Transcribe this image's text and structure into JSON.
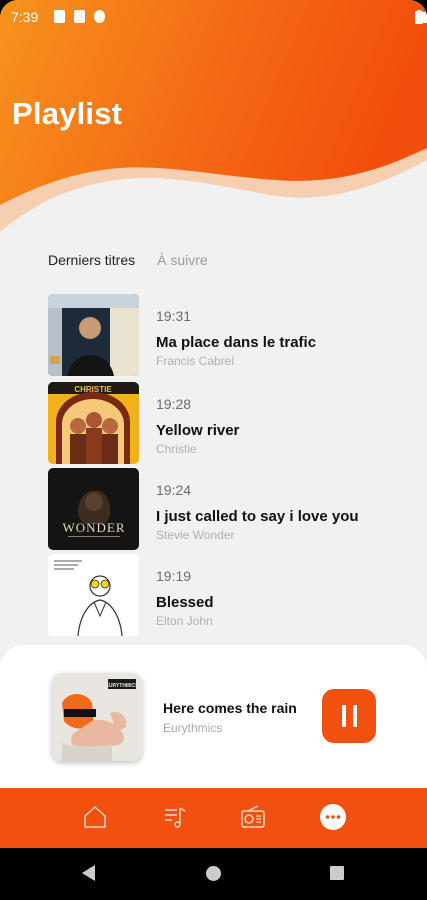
{
  "status_bar": {
    "time": "7:39"
  },
  "header": {
    "title": "Playlist"
  },
  "tabs": [
    {
      "label": "Derniers titres",
      "active": true
    },
    {
      "label": "À suivre",
      "active": false
    }
  ],
  "tracks": [
    {
      "time": "19:31",
      "title": "Ma place dans le trafic",
      "artist": "Francis Cabrel"
    },
    {
      "time": "19:28",
      "title": "Yellow river",
      "artist": "Christie"
    },
    {
      "time": "19:24",
      "title": "I just called to say i love you",
      "artist": "Stevie Wonder"
    },
    {
      "time": "19:19",
      "title": "Blessed",
      "artist": "Elton John"
    }
  ],
  "cover_text": {
    "christie": "CHRISTIE",
    "wonder": "WONDER",
    "eurythmics": "EURYTHMICS"
  },
  "now_playing": {
    "title": "Here comes the rain",
    "artist": "Eurythmics",
    "state": "playing"
  },
  "bottom_nav": [
    {
      "icon": "home-icon"
    },
    {
      "icon": "playlist-icon"
    },
    {
      "icon": "radio-icon"
    },
    {
      "icon": "more-icon",
      "active": true
    }
  ],
  "colors": {
    "accent": "#f2500f",
    "accent_light": "#f79a2a",
    "background": "#f1f1f1"
  }
}
